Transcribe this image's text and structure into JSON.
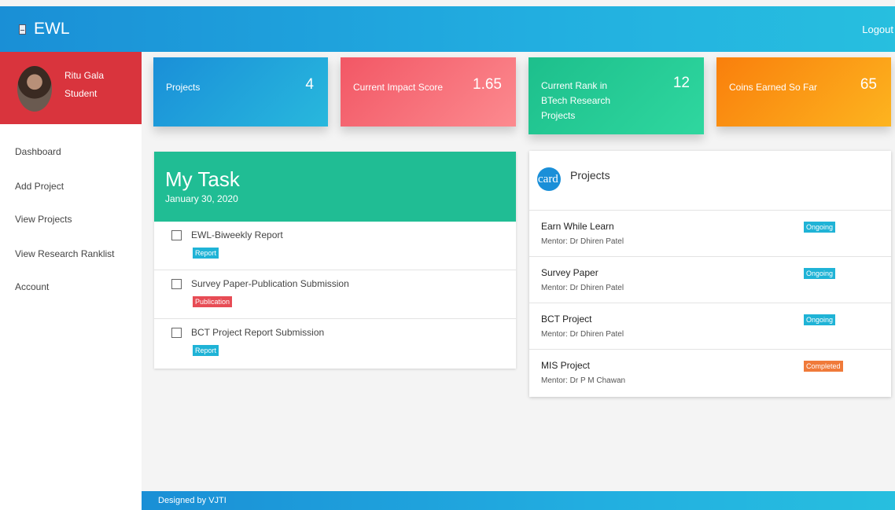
{
  "header": {
    "brand": "EWL",
    "brand_icon": "document-icon",
    "logout": "Logout"
  },
  "profile": {
    "name": "Ritu Gala",
    "role": "Student"
  },
  "sidebar": {
    "items": [
      {
        "label": "Dashboard"
      },
      {
        "label": "Add Project"
      },
      {
        "label": "View Projects"
      },
      {
        "label": "View Research Ranklist"
      },
      {
        "label": "Account"
      }
    ]
  },
  "stats": [
    {
      "label": "Projects",
      "value": "4",
      "color": "#1a8fd8"
    },
    {
      "label": "Current Impact Score",
      "value": "1.65",
      "color": "#f25765"
    },
    {
      "label": "Current Rank in BTech Research Projects",
      "line1": "Current Rank in",
      "line2": "BTech Research",
      "line3": "Projects",
      "value": "12",
      "color": "#1dbf8c"
    },
    {
      "label": "Coins Earned So Far",
      "value": "65",
      "color": "#f97f0c"
    }
  ],
  "tasks": {
    "title": "My Task",
    "date": "January 30, 2020",
    "items": [
      {
        "name": "EWL-Biweekly Report",
        "tag": "Report",
        "checked": false
      },
      {
        "name": "Survey Paper-Publication Submission",
        "tag": "Publication",
        "checked": false
      },
      {
        "name": "BCT Project Report Submission",
        "tag": "Report",
        "checked": false
      }
    ]
  },
  "projects": {
    "title": "Projects",
    "logo_text": "card",
    "items": [
      {
        "name": "Earn While Learn",
        "mentor": "Mentor: Dr Dhiren Patel",
        "status": "Ongoing"
      },
      {
        "name": "Survey Paper",
        "mentor": "Mentor: Dr Dhiren Patel",
        "status": "Ongoing"
      },
      {
        "name": "BCT Project",
        "mentor": "Mentor: Dr Dhiren Patel",
        "status": "Ongoing"
      },
      {
        "name": "MIS Project",
        "mentor": "Mentor: Dr P M Chawan",
        "status": "Completed"
      }
    ]
  },
  "footer": {
    "text": "Designed by VJTI"
  }
}
